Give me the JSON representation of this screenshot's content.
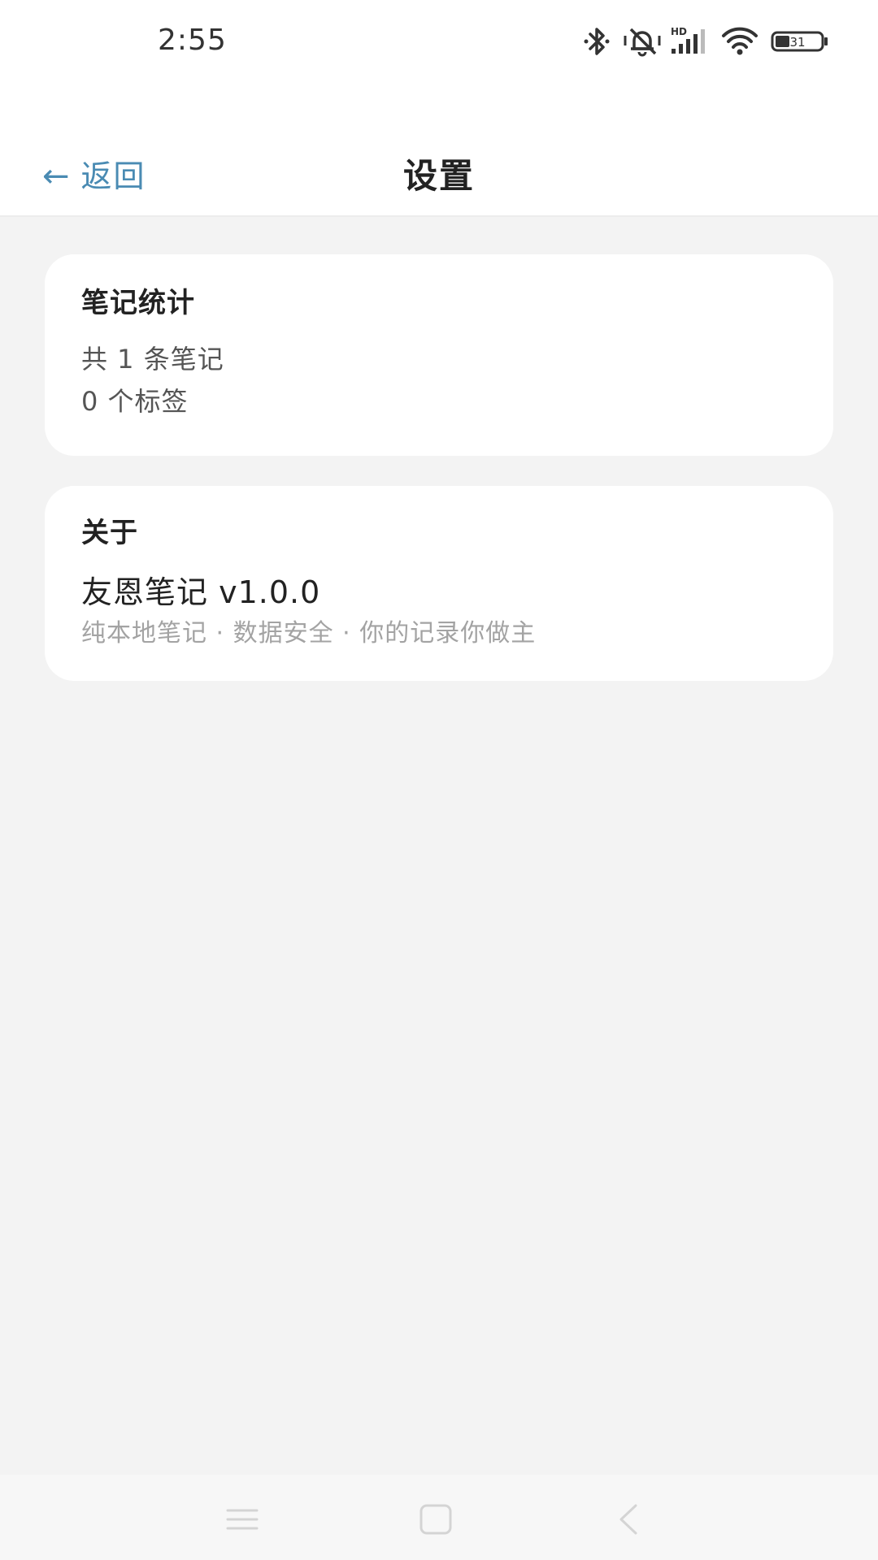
{
  "status_bar": {
    "time": "2:55",
    "battery": "31",
    "network_label": "HD",
    "icons": [
      "bluetooth-icon",
      "mute-icon",
      "signal-icon",
      "wifi-icon",
      "battery-icon"
    ]
  },
  "header": {
    "back_arrow": "←",
    "back_label": "返回",
    "title": "设置"
  },
  "stats_card": {
    "title": "笔记统计",
    "notes_count": "共 1 条笔记",
    "tags_count": "0 个标签"
  },
  "about_card": {
    "title": "关于",
    "app_name": "友恩笔记 v1.0.0",
    "tagline": "纯本地笔记 · 数据安全 · 你的记录你做主"
  },
  "nav_bar": {
    "buttons": [
      "menu-icon",
      "home-icon",
      "back-icon"
    ]
  },
  "colors": {
    "accent": "#4a8bb3",
    "background": "#f3f3f3",
    "card": "#ffffff",
    "muted_text": "#a3a3a3"
  }
}
